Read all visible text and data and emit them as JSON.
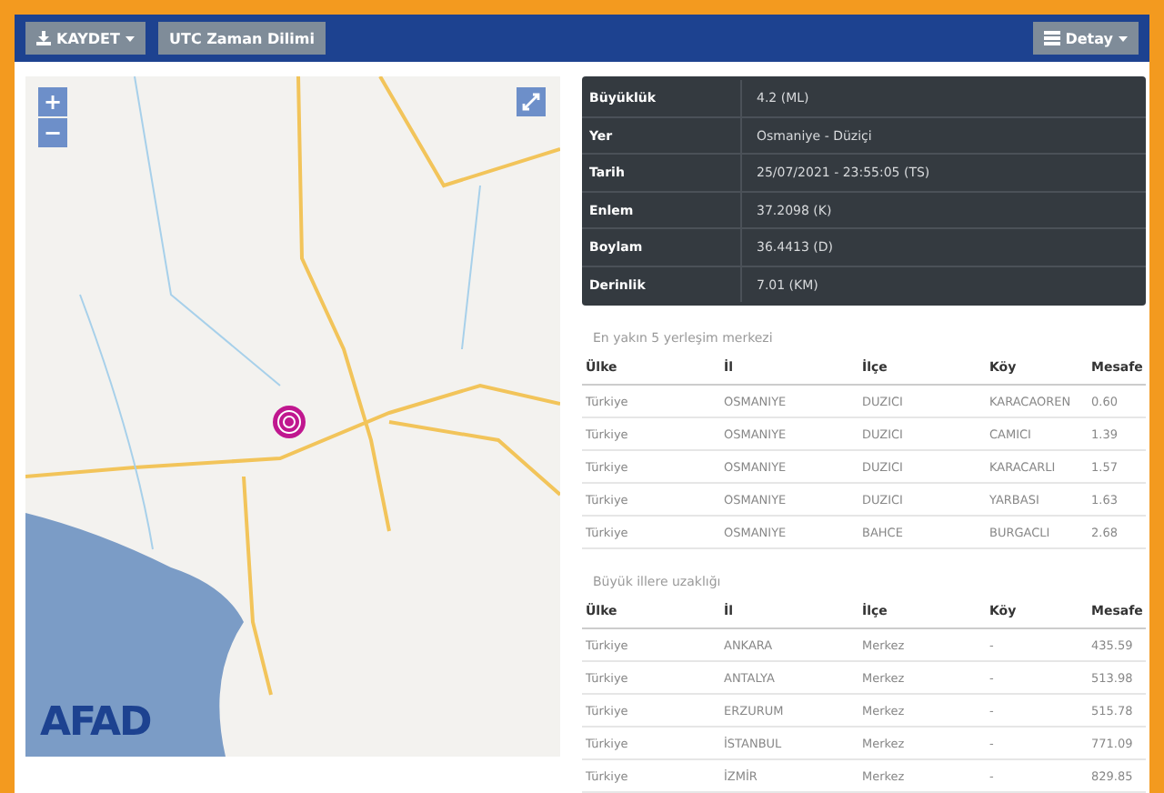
{
  "toolbar": {
    "save_button": "KAYDET",
    "utc_button": "UTC Zaman Dilimi",
    "detail_button": "Detay"
  },
  "map": {
    "zoom_in": "+",
    "zoom_out": "−",
    "logo": "AFAD"
  },
  "info": [
    {
      "label": "Büyüklük",
      "value": "4.2 (ML)"
    },
    {
      "label": "Yer",
      "value": "Osmaniye - Düziçi"
    },
    {
      "label": "Tarih",
      "value": "25/07/2021 - 23:55:05 (TS)"
    },
    {
      "label": "Enlem",
      "value": "37.2098 (K)"
    },
    {
      "label": "Boylam",
      "value": "36.4413 (D)"
    },
    {
      "label": "Derinlik",
      "value": "7.01 (KM)"
    }
  ],
  "tables": [
    {
      "caption": "En yakın 5 yerleşim merkezi",
      "columns": [
        "Ülke",
        "İl",
        "İlçe",
        "Köy",
        "Mesafe"
      ],
      "rows": [
        [
          "Türkiye",
          "OSMANIYE",
          "DUZICI",
          "KARACAOREN",
          "0.60"
        ],
        [
          "Türkiye",
          "OSMANIYE",
          "DUZICI",
          "CAMICI",
          "1.39"
        ],
        [
          "Türkiye",
          "OSMANIYE",
          "DUZICI",
          "KARACARLI",
          "1.57"
        ],
        [
          "Türkiye",
          "OSMANIYE",
          "DUZICI",
          "YARBASI",
          "1.63"
        ],
        [
          "Türkiye",
          "OSMANIYE",
          "BAHCE",
          "BURGACLI",
          "2.68"
        ]
      ]
    },
    {
      "caption": "Büyük illere uzaklığı",
      "columns": [
        "Ülke",
        "İl",
        "İlçe",
        "Köy",
        "Mesafe"
      ],
      "rows": [
        [
          "Türkiye",
          "ANKARA",
          "Merkez",
          "-",
          "435.59"
        ],
        [
          "Türkiye",
          "ANTALYA",
          "Merkez",
          "-",
          "513.98"
        ],
        [
          "Türkiye",
          "ERZURUM",
          "Merkez",
          "-",
          "515.78"
        ],
        [
          "Türkiye",
          "İSTANBUL",
          "Merkez",
          "-",
          "771.09"
        ],
        [
          "Türkiye",
          "İZMİR",
          "Merkez",
          "-",
          "829.85"
        ]
      ]
    }
  ]
}
